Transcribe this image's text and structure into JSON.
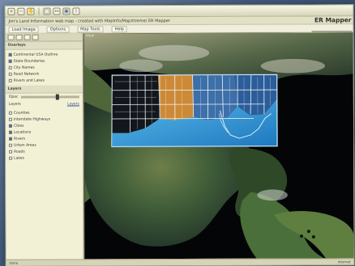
{
  "window": {
    "title": "Jim's Land Information web map - created with MapInfo/MapXtreme/ ER Mapper",
    "brand": "ER Mapper"
  },
  "menu": {
    "items": [
      "Load Image",
      "Options",
      "Map Tools",
      "Help"
    ]
  },
  "toolbar": {
    "buttons": [
      "zoom-in",
      "zoom-out",
      "pan",
      "select",
      "measure",
      "print",
      "info"
    ]
  },
  "left_panel": {
    "section_title": "Overlays",
    "overlays": [
      "Continental USA Outline",
      "State Boundaries",
      "City Names",
      "Road Network",
      "Rivers and Lakes"
    ],
    "layers_title": "Layers",
    "opacity_label": "Opac",
    "layers_link": "Layers",
    "layers": [
      "Counties",
      "Interstate Highways",
      "Cities",
      "Locations",
      "Rivers",
      "Urban Areas",
      "Roads",
      "Lakes"
    ]
  },
  "map": {
    "label": "View",
    "background": "#040506"
  },
  "status": {
    "left": "Done",
    "right": "Internet"
  }
}
